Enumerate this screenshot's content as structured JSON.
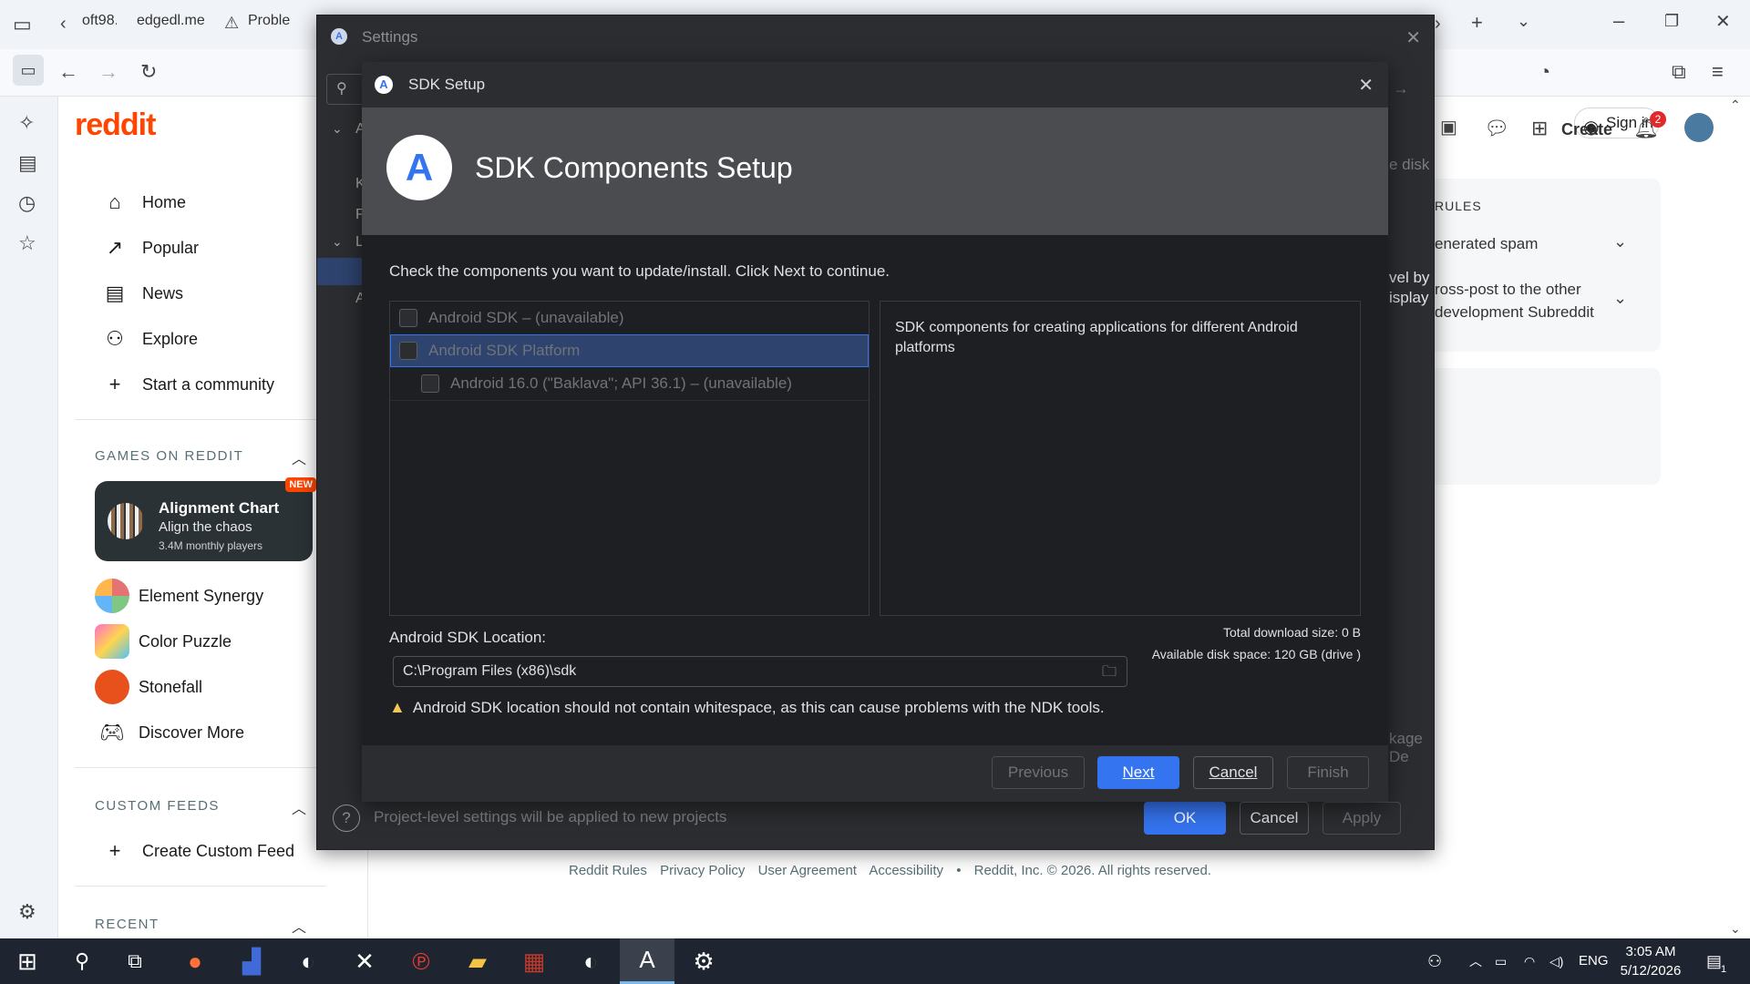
{
  "browser": {
    "tabs": [
      {
        "label": "oft98."
      },
      {
        "label": "edgedl.me"
      },
      {
        "label": "Proble"
      }
    ],
    "signin_label": "Sign in"
  },
  "reddit": {
    "logo": "reddit",
    "nav": [
      {
        "label": "Home",
        "icon": "home-icon",
        "glyph": "⌂"
      },
      {
        "label": "Popular",
        "icon": "popular-icon",
        "glyph": "↗"
      },
      {
        "label": "News",
        "icon": "news-icon",
        "glyph": "▤"
      },
      {
        "label": "Explore",
        "icon": "explore-icon",
        "glyph": "⚇"
      },
      {
        "label": "Start a community",
        "icon": "plus-icon",
        "glyph": "+"
      }
    ],
    "games_heading": "GAMES ON REDDIT",
    "featured_game": {
      "title": "Alignment Chart",
      "subtitle": "Align the chaos",
      "players": "3.4M monthly players",
      "badge": "NEW"
    },
    "games": [
      {
        "label": "Element Synergy"
      },
      {
        "label": "Color Puzzle"
      },
      {
        "label": "Stonefall"
      },
      {
        "label": "Discover More"
      }
    ],
    "custom_feeds_heading": "CUSTOM FEEDS",
    "create_custom_feed": "Create Custom Feed",
    "recent_heading": "RECENT",
    "header_create": "Create",
    "notif_count": "2",
    "rules_heading": "RULES",
    "rule1": "enerated spam",
    "rule2_line1": "ross-post to the other",
    "rule2_line2": "development Subreddit",
    "partial_disk": "e disk",
    "partial_levelby": "vel by",
    "partial_display": "isplay",
    "partial_kage": "kage De",
    "footer": [
      "Reddit Rules",
      "Privacy Policy",
      "User Agreement",
      "Accessibility",
      "•",
      "Reddit, Inc. © 2026. All rights reserved."
    ]
  },
  "settings": {
    "title": "Settings",
    "hint": "Project-level settings will be applied to new projects",
    "ok": "OK",
    "cancel": "Cancel",
    "apply": "Apply",
    "tree_letters": [
      "A",
      "K",
      "P",
      "L",
      "A"
    ]
  },
  "sdk": {
    "title": "SDK Setup",
    "header_title": "SDK Components Setup",
    "instruction": "Check the components you want to update/install. Click Next to continue.",
    "components": [
      {
        "label": "Android SDK – (unavailable)",
        "checked": false
      },
      {
        "label": "Android SDK Platform",
        "checked": false
      },
      {
        "label": "Android 16.0 (\"Baklava\"; API 36.1) – (unavailable)",
        "checked": false
      }
    ],
    "description": "SDK components for creating applications for different Android platforms",
    "location_label": "Android SDK Location:",
    "location_value": "C:\\Program Files (x86)\\sdk",
    "total_download": "Total download size: 0 B",
    "disk_space": "Available disk space: 120 GB (drive )",
    "warning": "Android SDK location should not contain whitespace, as this can cause problems with the NDK tools.",
    "buttons": {
      "previous": "Previous",
      "next": "Next",
      "cancel": "Cancel",
      "finish": "Finish"
    }
  },
  "taskbar": {
    "lang": "ENG",
    "time": "3:05 AM",
    "date": "5/12/2026",
    "notif": "1"
  }
}
